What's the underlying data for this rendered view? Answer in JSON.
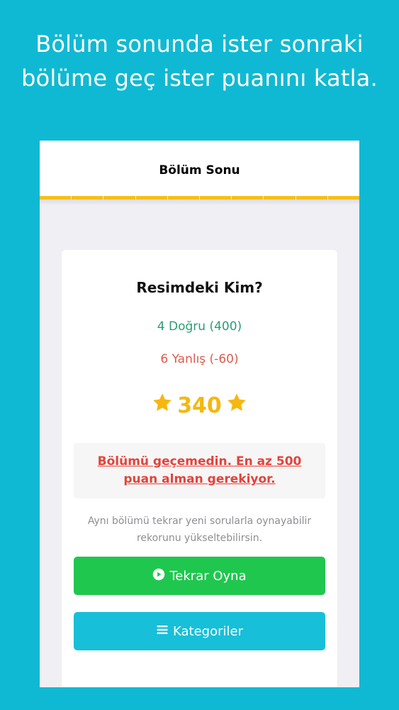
{
  "promo": {
    "line1": "Bölüm sonunda ister sonraki",
    "line2": "bölüme geç ister puanını katla."
  },
  "nav": {
    "title": "Bölüm Sonu"
  },
  "progress": {
    "segments": 10
  },
  "result": {
    "category": "Resimdeki Kim?",
    "correct": "4 Doğru (400)",
    "wrong": "6 Yanlış (-60)",
    "score": "340"
  },
  "alert": {
    "line1": "Bölümü geçemedin. En az 500",
    "line2": "puan alman gerekiyor."
  },
  "hint": {
    "line1": "Aynı bölümü tekrar yeni sorularla oynayabilir",
    "line2": "rekorunu yükseltebilirsin."
  },
  "buttons": {
    "replay": "Tekrar Oyna",
    "categories": "Kategoriler"
  },
  "colors": {
    "background": "#10b9d3",
    "progress": "#f4c01a",
    "correct": "#2a9d72",
    "wrong": "#e05a4b",
    "score": "#f5b710",
    "alert": "#e5423a",
    "replay_button": "#1fc74f",
    "categories_button": "#17bfd8"
  },
  "icons": {
    "score": "star-icon",
    "replay": "play-circle-icon",
    "categories": "list-icon"
  }
}
